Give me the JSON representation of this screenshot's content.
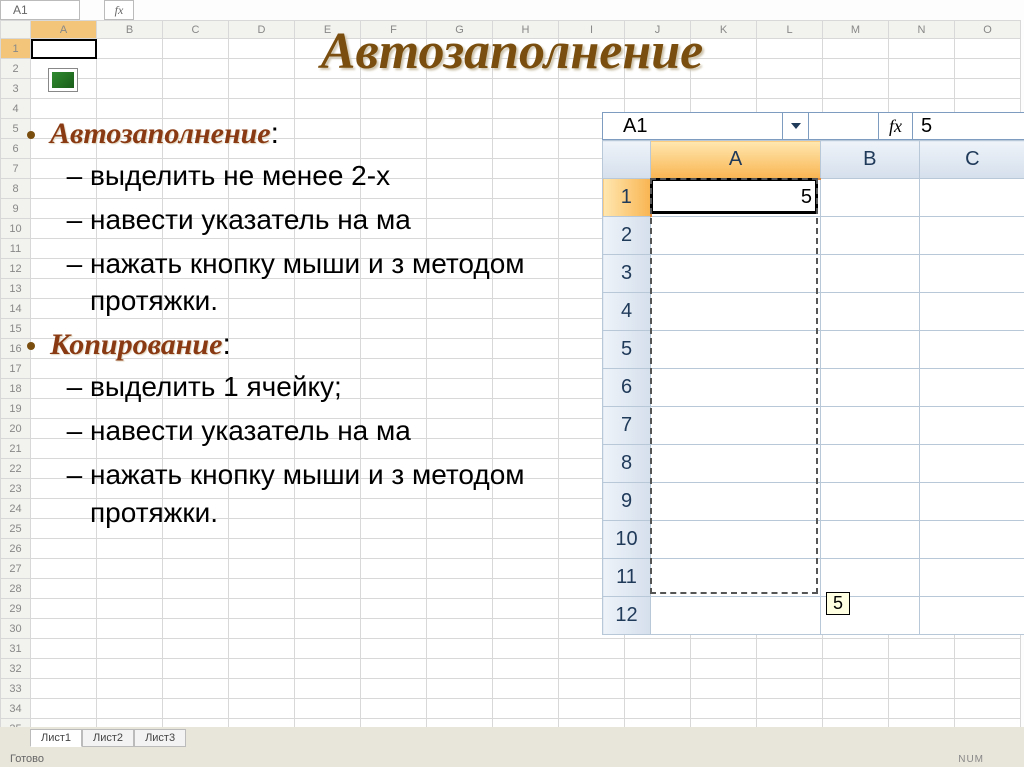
{
  "bg": {
    "namebox": "A1",
    "fx": "fx",
    "columns": [
      "A",
      "B",
      "C",
      "D",
      "E",
      "F",
      "G",
      "H",
      "I",
      "J",
      "K",
      "L",
      "M",
      "N",
      "O"
    ],
    "rows": 35,
    "sheets": [
      "Лист1",
      "Лист2",
      "Лист3"
    ],
    "ready": "Готово",
    "num": "NUM"
  },
  "slide": {
    "title": "Автозаполнение",
    "excel_icon_letter": "X",
    "sections": [
      {
        "head": "Автозаполнение",
        "colon": ":",
        "items": [
          "выделить не менее 2-х",
          "навести указатель на ма",
          "нажать кнопку мыши и з методом протяжки."
        ]
      },
      {
        "head": "Копирование",
        "colon": ":",
        "items": [
          "выделить 1 ячейку;",
          "навести указатель на ма",
          "нажать кнопку мыши и з методом протяжки."
        ]
      }
    ]
  },
  "mini": {
    "namebox": "A1",
    "fx_label": "fx",
    "fx_value": "5",
    "columns": [
      "A",
      "B",
      "C"
    ],
    "rows": 12,
    "a1_value": "5",
    "tooltip": "5"
  }
}
